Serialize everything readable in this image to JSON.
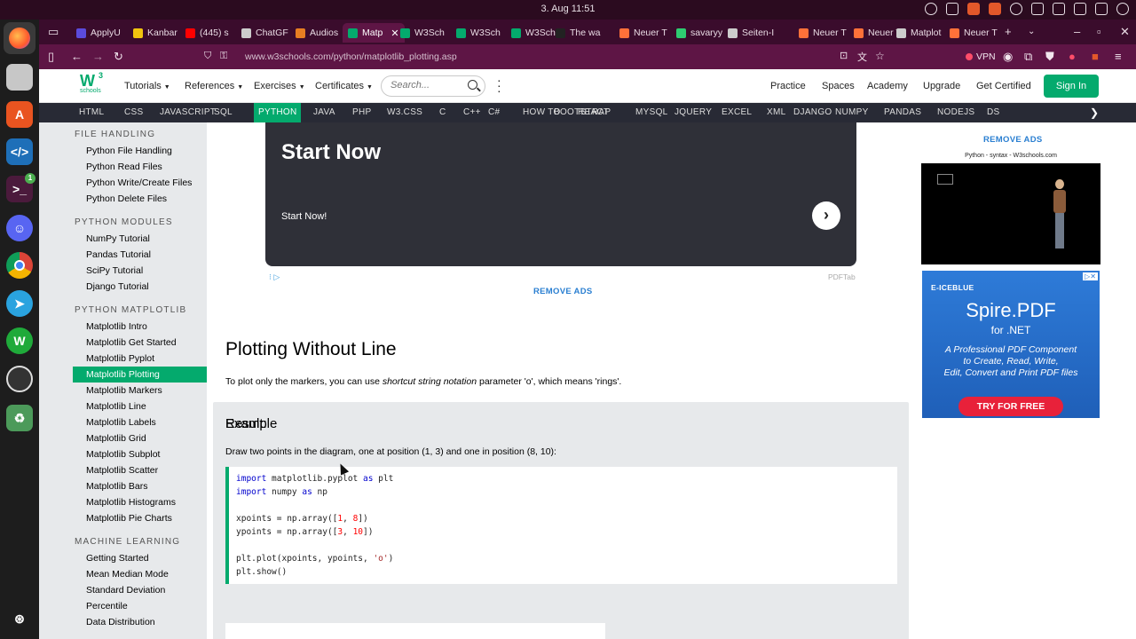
{
  "os": {
    "clock": "3. Aug 11:51"
  },
  "browser": {
    "tabs": [
      {
        "label": "ApplyU",
        "fav": "#5b4bdb"
      },
      {
        "label": "Kanbar",
        "fav": "#f1c40f"
      },
      {
        "label": "(445) s",
        "fav": "#ff0000"
      },
      {
        "label": "ChatGF",
        "fav": "#cccccc"
      },
      {
        "label": "Audios",
        "fav": "#e67e22"
      },
      {
        "label": "Matp",
        "fav": "#04aa6d"
      },
      {
        "label": "W3Sch",
        "fav": "#04aa6d"
      },
      {
        "label": "W3Sch",
        "fav": "#04aa6d"
      },
      {
        "label": "W3Sch",
        "fav": "#04aa6d"
      },
      {
        "label": "The wa",
        "fav": "#222222"
      },
      {
        "label": "Neuer T",
        "fav": "#ff7139"
      },
      {
        "label": "savaryy",
        "fav": "#2ecc71"
      },
      {
        "label": "Seiten-I",
        "fav": "#cccccc"
      },
      {
        "label": "Neuer T",
        "fav": "#ff7139"
      },
      {
        "label": "Neuer T",
        "fav": "#ff7139"
      },
      {
        "label": "Matplot",
        "fav": "#cccccc"
      },
      {
        "label": "Neuer T",
        "fav": "#ff7139"
      }
    ],
    "url": "www.w3schools.com/python/matplotlib_plotting.asp",
    "vpn_label": "VPN"
  },
  "header": {
    "logo_letter": "W",
    "logo_sup": "3",
    "logo_sub": "schools",
    "menus": [
      "Tutorials",
      "References",
      "Exercises",
      "Certificates"
    ],
    "search_placeholder": "Search...",
    "right_links": [
      "Practice",
      "Spaces",
      "Academy",
      "Upgrade",
      "Get Certified"
    ],
    "signin": "Sign In"
  },
  "topnav": [
    "HTML",
    "CSS",
    "JAVASCRIPT",
    "SQL",
    "PYTHON",
    "JAVA",
    "PHP",
    "W3.CSS",
    "C",
    "C++",
    "C#",
    "HOW TO",
    "BOOTSTRAP",
    "REACT",
    "MYSQL",
    "JQUERY",
    "EXCEL",
    "XML",
    "DJANGO",
    "NUMPY",
    "PANDAS",
    "NODEJS",
    "DS"
  ],
  "topnav_active": "PYTHON",
  "sidebar": {
    "sections": [
      {
        "title": "FILE HANDLING",
        "items": [
          "Python File Handling",
          "Python Read Files",
          "Python Write/Create Files",
          "Python Delete Files"
        ]
      },
      {
        "title": "PYTHON MODULES",
        "items": [
          "NumPy Tutorial",
          "Pandas Tutorial",
          "SciPy Tutorial",
          "Django Tutorial"
        ]
      },
      {
        "title": "PYTHON MATPLOTLIB",
        "items": [
          "Matplotlib Intro",
          "Matplotlib Get Started",
          "Matplotlib Pyplot",
          "Matplotlib Plotting",
          "Matplotlib Markers",
          "Matplotlib Line",
          "Matplotlib Labels",
          "Matplotlib Grid",
          "Matplotlib Subplot",
          "Matplotlib Scatter",
          "Matplotlib Bars",
          "Matplotlib Histograms",
          "Matplotlib Pie Charts"
        ]
      },
      {
        "title": "MACHINE LEARNING",
        "items": [
          "Getting Started",
          "Mean Median Mode",
          "Standard Deviation",
          "Percentile",
          "Data Distribution"
        ]
      }
    ],
    "active_item": "Matplotlib Plotting"
  },
  "main": {
    "banner_title": "Start Now",
    "banner_sub": "Start Now!",
    "banner_source": "PDFTab",
    "remove_ads": "REMOVE ADS",
    "heading": "Plotting Without Line",
    "intro_pre": "To plot only the markers, you can use ",
    "intro_em": "shortcut string notation",
    "intro_post": " parameter 'o', which means 'rings'.",
    "example_title": "Example",
    "example_desc": "Draw two points in the diagram, one at position (1, 3) and one in position (8, 10):",
    "result_title": "Result:"
  },
  "right": {
    "remove_ads": "REMOVE ADS",
    "video_title": "Python - syntax - W3schools.com",
    "spire_brand": "E-ICEBLUE",
    "spire_product": "Spire.PDF",
    "spire_for": "for .NET",
    "spire_tag_1": "A Professional PDF Component",
    "spire_tag_2": "to Create, Read, Write,",
    "spire_tag_3": "Edit, Convert and Print PDF files",
    "spire_cta": "TRY FOR FREE"
  }
}
